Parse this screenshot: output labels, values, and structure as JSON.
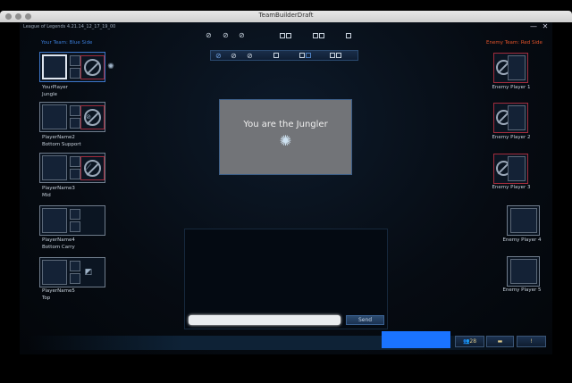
{
  "window": {
    "title": "TeamBuilderDraft"
  },
  "app": {
    "title": "League of Legends 4.21.14_12_17_19_00",
    "minimize": "—",
    "close": "✕"
  },
  "your_team": {
    "label": "Your Team: Blue Side",
    "label_color": "#3a7bd5",
    "players": [
      {
        "name": "YourPlayer",
        "position": "Jungle",
        "role_icon": "jungle-icon",
        "role_glyph": "✺",
        "banned": true
      },
      {
        "name": "PlayerName2",
        "position": "Bottom Support",
        "role_icon": "support-icon",
        "role_glyph": "⊘",
        "banned": true
      },
      {
        "name": "PlayerName3",
        "position": "Mid",
        "role_icon": "mid-icon",
        "role_glyph": "⟋",
        "banned": true
      },
      {
        "name": "PlayerName4",
        "position": "Bottom Carry",
        "role_icon": "",
        "role_glyph": "",
        "banned": false
      },
      {
        "name": "PlayerName5",
        "position": "Top",
        "role_icon": "top-icon",
        "role_glyph": "◩",
        "banned": false
      }
    ]
  },
  "enemy_team": {
    "label": "Enemy Team: Red Side",
    "label_color": "#e0522a",
    "players": [
      {
        "name": "Enemy Player 1",
        "banned": true
      },
      {
        "name": "Enemy Player 2",
        "banned": true
      },
      {
        "name": "Enemy Player 3",
        "banned": true
      },
      {
        "name": "Enemy Player 4",
        "banned": false
      },
      {
        "name": "Enemy Player 5",
        "banned": false
      }
    ]
  },
  "role_panel": {
    "message": "You are the Jungler",
    "icon": "jungle-icon"
  },
  "chat": {
    "send_label": "Send"
  },
  "footer": {
    "friends_count": "28"
  }
}
